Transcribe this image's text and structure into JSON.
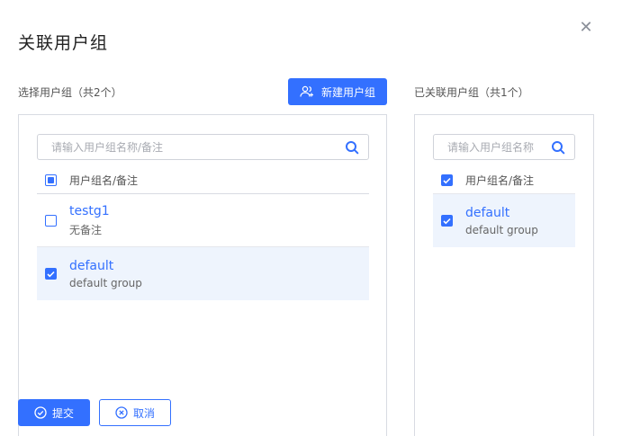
{
  "dialog": {
    "title": "关联用户组",
    "close_icon": "close-icon"
  },
  "left": {
    "label": "选择用户组（共2个）",
    "new_group_label": "新建用户组",
    "search_placeholder": "请输入用户组名称/备注",
    "search_value": "",
    "header": "用户组名/备注",
    "rows": [
      {
        "name": "testg1",
        "note": "无备注",
        "checked": false
      },
      {
        "name": "default",
        "note": "default group",
        "checked": true
      }
    ]
  },
  "right": {
    "label": "已关联用户组（共1个）",
    "search_placeholder": "请输入用户组名称",
    "search_value": "",
    "header": "用户组名/备注",
    "rows": [
      {
        "name": "default",
        "note": "default group",
        "checked": true
      }
    ]
  },
  "actions": {
    "submit_label": "提交",
    "cancel_label": "取消"
  },
  "colors": {
    "accent": "#3370ff",
    "selected_row": "#eef4fd",
    "border": "#d8dbe2"
  }
}
